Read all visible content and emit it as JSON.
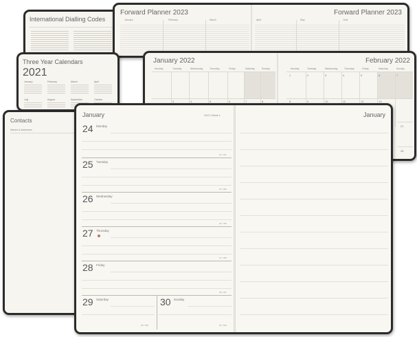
{
  "dialling": {
    "title": "International Dialling Codes"
  },
  "forward_planner": {
    "title_left": "Forward Planner 2023",
    "title_right": "Forward Planner 2023",
    "months": [
      "January",
      "February",
      "March",
      "April",
      "May",
      "June"
    ]
  },
  "three_year": {
    "title": "Three Year Calendars",
    "year": "2021",
    "months": [
      "January",
      "February",
      "March",
      "April",
      "July",
      "August",
      "September",
      "October"
    ]
  },
  "month_view": {
    "title_left": "January 2022",
    "title_right": "February 2022",
    "weekdays": [
      "Monday",
      "Tuesday",
      "Wednesday",
      "Thursday",
      "Friday",
      "Saturday",
      "Sunday"
    ],
    "left_dates": [
      "3",
      "4",
      "5",
      "6",
      "7",
      "8",
      "9",
      "10"
    ],
    "right_dates": [
      "1",
      "2",
      "3",
      "4",
      "5",
      "6",
      "7",
      "8",
      "9",
      "10",
      "11",
      "12",
      "13"
    ],
    "side_dates": [
      "21",
      "28"
    ]
  },
  "contacts": {
    "title": "Contacts",
    "subtitle": "Names & Addresses"
  },
  "week_view": {
    "month_left": "January",
    "month_right": "January",
    "week_label": "2022  3  Week 4",
    "days": [
      {
        "num": "24",
        "name": "Monday",
        "foot": "24 / 341"
      },
      {
        "num": "25",
        "name": "Tuesday",
        "foot": "25 / 340"
      },
      {
        "num": "26",
        "name": "Wednesday",
        "foot": "26 / 339"
      },
      {
        "num": "27",
        "name": "Thursday",
        "foot": "27 / 338"
      },
      {
        "num": "28",
        "name": "Friday",
        "foot": "28 / 337"
      },
      {
        "num": "29",
        "name": "Saturday",
        "foot": "29 / 336"
      },
      {
        "num": "30",
        "name": "Sunday",
        "foot": "30 / 335"
      }
    ]
  }
}
